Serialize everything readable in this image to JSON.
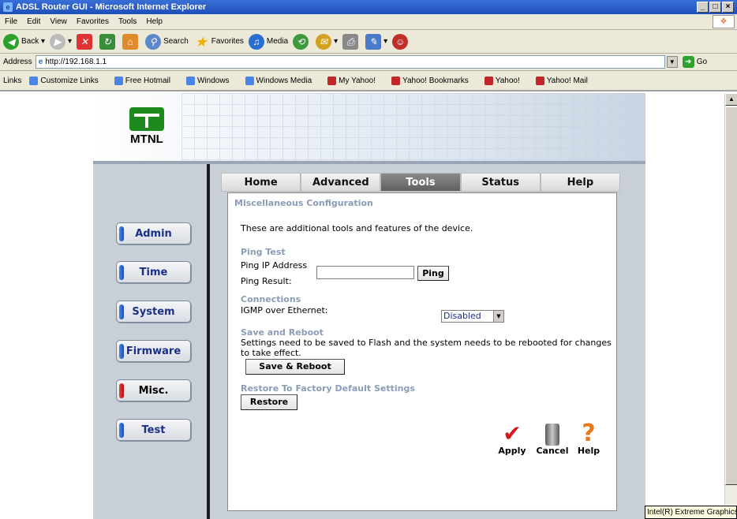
{
  "window": {
    "title": "ADSL Router GUI - Microsoft Internet Explorer",
    "controls": [
      "_",
      "□",
      "×"
    ]
  },
  "menu": {
    "items": [
      "File",
      "Edit",
      "View",
      "Favorites",
      "Tools",
      "Help"
    ]
  },
  "toolbar": {
    "back": "Back",
    "search": "Search",
    "favorites": "Favorites",
    "media": "Media"
  },
  "address": {
    "label": "Address",
    "url": "http://192.168.1.1",
    "go": "Go"
  },
  "links": {
    "label": "Links",
    "items": [
      "Customize Links",
      "Free Hotmail",
      "Windows",
      "Windows Media",
      "My Yahoo!",
      "Yahoo! Bookmarks",
      "Yahoo!",
      "Yahoo! Mail"
    ]
  },
  "brand": {
    "name": "MTNL"
  },
  "tabs": [
    {
      "label": "Home"
    },
    {
      "label": "Advanced"
    },
    {
      "label": "Tools",
      "active": true
    },
    {
      "label": "Status"
    },
    {
      "label": "Help"
    }
  ],
  "sidebar": [
    {
      "label": "Admin"
    },
    {
      "label": "Time"
    },
    {
      "label": "System"
    },
    {
      "label": "Firmware"
    },
    {
      "label": "Misc.",
      "active": true
    },
    {
      "label": "Test"
    }
  ],
  "content": {
    "title": "Miscellaneous Configuration",
    "intro": "These are additional tools and features of the device.",
    "ping": {
      "heading": "Ping Test",
      "ip_label": "Ping IP Address",
      "ip_value": "",
      "button": "Ping",
      "result_label": "Ping Result:"
    },
    "connections": {
      "heading": "Connections",
      "igmp_label": "IGMP over Ethernet:",
      "igmp_value": "Disabled"
    },
    "reboot": {
      "heading": "Save and Reboot",
      "text_line1": "Settings need to be saved to Flash and the system needs to be rebooted for changes",
      "text_line2": "to take effect.",
      "button": "Save & Reboot"
    },
    "restore": {
      "heading": "Restore To Factory Default Settings",
      "button": "Restore"
    },
    "actions": {
      "apply": "Apply",
      "cancel": "Cancel",
      "help": "Help"
    }
  },
  "status_tooltip": "Intel(R) Extreme Graphics"
}
